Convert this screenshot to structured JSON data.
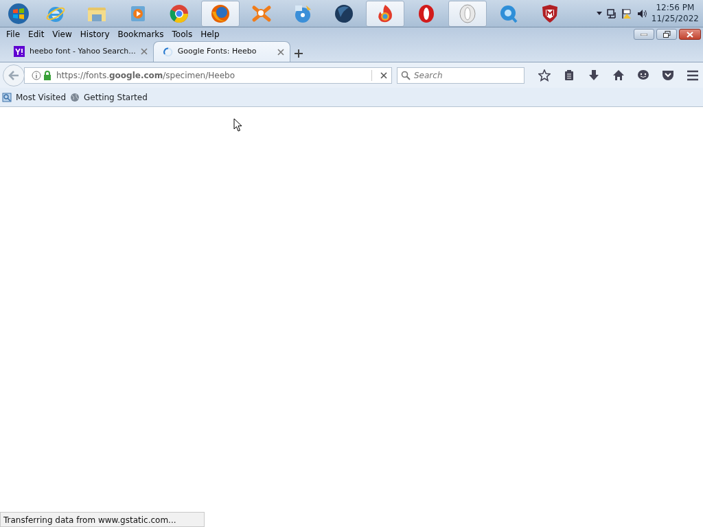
{
  "taskbar": {
    "apps": [
      {
        "selected": false
      },
      {
        "selected": false
      },
      {
        "selected": false
      },
      {
        "selected": false
      },
      {
        "selected": true
      },
      {
        "selected": false
      },
      {
        "selected": false
      },
      {
        "selected": false
      },
      {
        "selected": true
      },
      {
        "selected": false
      },
      {
        "selected": true
      },
      {
        "selected": false
      },
      {
        "selected": false
      }
    ],
    "clock": {
      "time": "12:56 PM",
      "date": "11/25/2022"
    }
  },
  "menu": [
    "File",
    "Edit",
    "View",
    "History",
    "Bookmarks",
    "Tools",
    "Help"
  ],
  "tabs": [
    {
      "title": "heebo font - Yahoo Search...",
      "selected": false,
      "loading": false
    },
    {
      "title": "Google Fonts: Heebo",
      "selected": true,
      "loading": true
    }
  ],
  "address": {
    "url": "https://fonts.**google.com**/specimen/Heebo"
  },
  "search": {
    "placeholder": "Search"
  },
  "bookmarks": [
    "Most Visited",
    "Getting Started"
  ],
  "status_bar": "Transferring data from www.gstatic.com..."
}
